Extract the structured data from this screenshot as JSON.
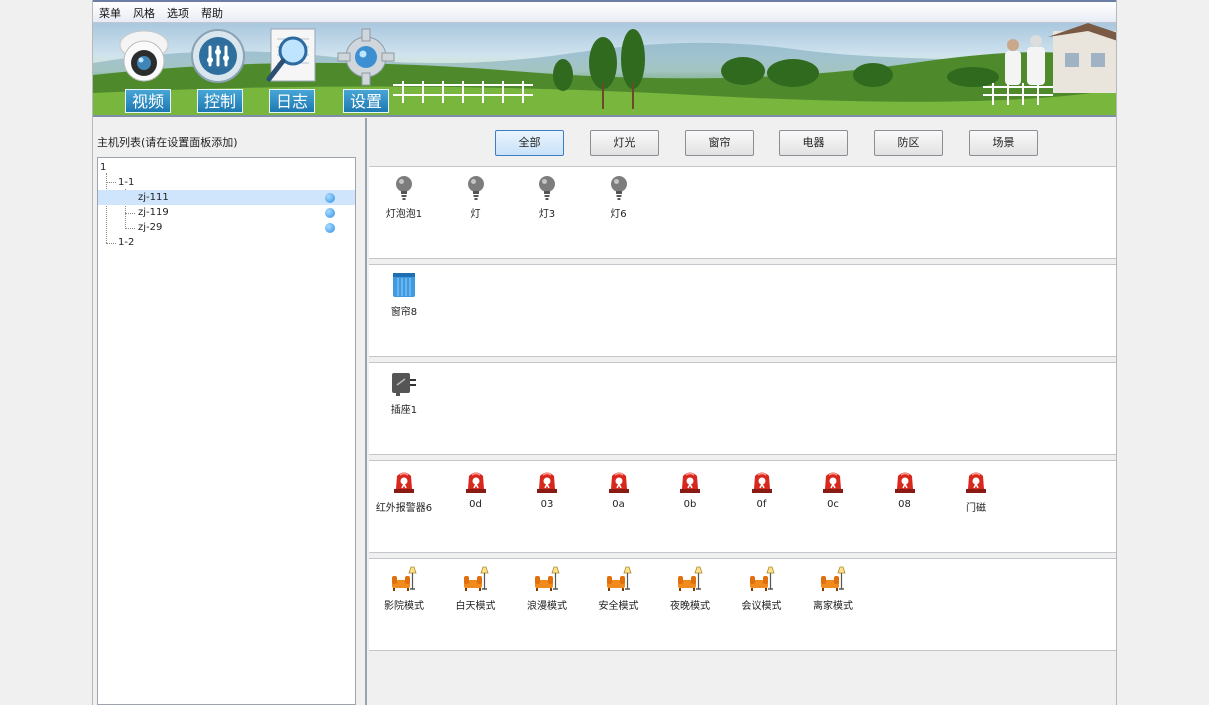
{
  "menu": [
    "菜单",
    "风格",
    "选项",
    "帮助"
  ],
  "nav": {
    "video": "视频",
    "control": "控制",
    "log": "日志",
    "settings": "设置"
  },
  "host_panel": {
    "title": "主机列表(请在设置面板添加)",
    "tree": {
      "root": "1",
      "group1": "1-1",
      "items": [
        "zj-111",
        "zj-119",
        "zj-29"
      ],
      "group2": "1-2",
      "selected_index": 0
    }
  },
  "filters": [
    "全部",
    "灯光",
    "窗帘",
    "电器",
    "防区",
    "场景"
  ],
  "active_filter": 0,
  "sections": {
    "lights": [
      "灯泡泡1",
      "灯",
      "灯3",
      "灯6"
    ],
    "curtains": [
      "窗帘8"
    ],
    "appliances": [
      "插座1"
    ],
    "zones": [
      "红外报警器6",
      "0d",
      "03",
      "0a",
      "0b",
      "0f",
      "0c",
      "08",
      "门磁"
    ],
    "scenes": [
      "影院模式",
      "白天模式",
      "浪漫模式",
      "安全模式",
      "夜晚模式",
      "会议模式",
      "离家模式"
    ]
  },
  "colors": {
    "nav_button": "#1d78b2",
    "selected_row": "#cfe5fb",
    "online_dot": "#2d8ee4",
    "alarm_red": "#d8281e",
    "scene_orange": "#f08a1c"
  },
  "icons": {
    "light": "bulb-icon",
    "curtain": "curtain-icon",
    "appliance": "socket-icon",
    "zone": "alarm-icon",
    "scene": "sofa-lamp-icon"
  }
}
